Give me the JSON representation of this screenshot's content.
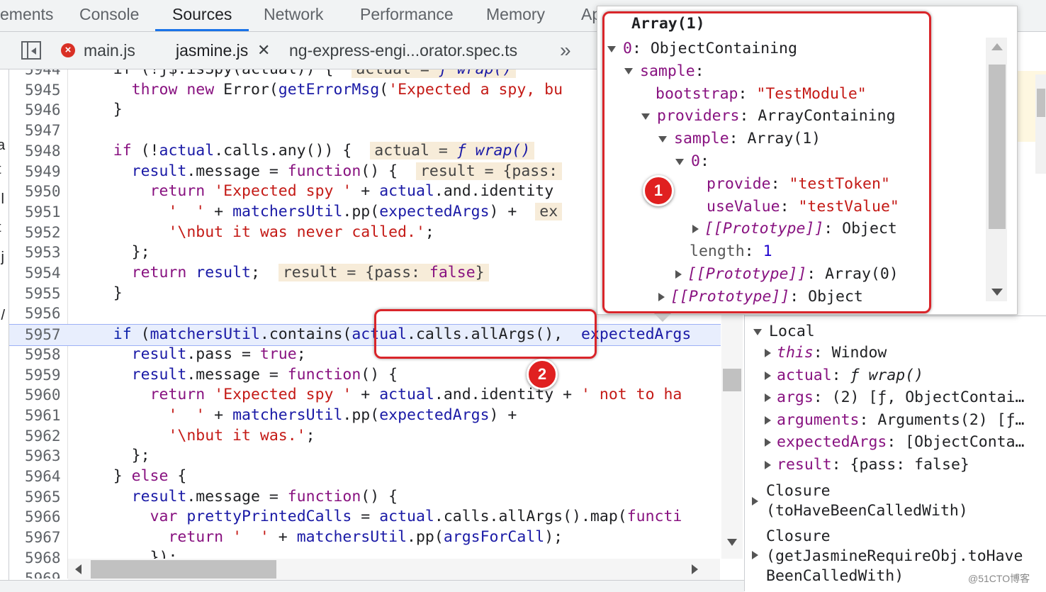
{
  "devtools_tabs": [
    "ements",
    "Console",
    "Sources",
    "Network",
    "Performance",
    "Memory",
    "Ap"
  ],
  "active_tab": "Sources",
  "file_tabs": [
    {
      "label": "main.js",
      "error": true
    },
    {
      "label": "jasmine.js",
      "active": true,
      "close": "✕"
    },
    {
      "label": "ng-express-engi...orator.spec.ts"
    }
  ],
  "more_tabs": "»",
  "nav_fragments": [
    ":",
    "a",
    "t",
    ".l",
    "t",
    ".j",
    ":/"
  ],
  "code_lines": [
    {
      "n": "5944",
      "html": "    if (!j$.isSpy(actual)) {  <span class=\"pill\">actual = <i>ƒ wrap()</i></span>"
    },
    {
      "n": "5945",
      "html": "      <span class=\"kw\">throw new</span> Error(<span class=\"fn\">getErrorMsg</span>(<span class=\"str\">'Expected a spy, bu</span>"
    },
    {
      "n": "5946",
      "html": "    }"
    },
    {
      "n": "5947",
      "html": ""
    },
    {
      "n": "5948",
      "html": "    <span class=\"kw\">if</span> (!<span class=\"var\">actual</span>.calls.any()) {  <span class=\"pill\">actual = <i>ƒ wrap()</i></span>"
    },
    {
      "n": "5949",
      "html": "      <span class=\"var\">result</span>.message = <span class=\"kw\">function</span>() {  <span class=\"pill\">result = {pass:</span>"
    },
    {
      "n": "5950",
      "html": "        <span class=\"kw\">return</span> <span class=\"str\">'Expected spy '</span> + <span class=\"var\">actual</span>.and.identity"
    },
    {
      "n": "5951",
      "html": "          <span class=\"str\">'  '</span> + <span class=\"var\">matchersUtil</span>.pp(<span class=\"var\">expectedArgs</span>) +  <span class=\"pill\">ex</span>"
    },
    {
      "n": "5952",
      "html": "          <span class=\"str\">'\\nbut it was never called.'</span>;"
    },
    {
      "n": "5953",
      "html": "      };"
    },
    {
      "n": "5954",
      "html": "      <span class=\"kw\">return</span> <span class=\"var\">result</span>;  <span class=\"pill\">result = {pass: <span class=\"kw\">false</span>}</span>"
    },
    {
      "n": "5955",
      "html": "    }"
    },
    {
      "n": "5956",
      "html": ""
    },
    {
      "n": "5957",
      "html": "    <span class=\"kwb\">if</span> (<span class=\"var\">matchersUtil</span>.contains(<span class=\"var\">actual</span>.calls.allArgs(),  <span class=\"var\">expectedArgs</span>",
      "exec": true
    },
    {
      "n": "5958",
      "html": "      <span class=\"var\">result</span>.pass = <span class=\"kw\">true</span>;"
    },
    {
      "n": "5959",
      "html": "      <span class=\"var\">result</span>.message = <span class=\"kw\">function</span>() {"
    },
    {
      "n": "5960",
      "html": "        <span class=\"kw\">return</span> <span class=\"str\">'Expected spy '</span> + <span class=\"var\">actual</span>.and.identity + <span class=\"str\">' not to ha</span>"
    },
    {
      "n": "5961",
      "html": "          <span class=\"str\">'  '</span> + <span class=\"var\">matchersUtil</span>.pp(<span class=\"var\">expectedArgs</span>) +"
    },
    {
      "n": "5962",
      "html": "          <span class=\"str\">'\\nbut it was.'</span>;"
    },
    {
      "n": "5963",
      "html": "      };"
    },
    {
      "n": "5964",
      "html": "    } <span class=\"kw\">else</span> {"
    },
    {
      "n": "5965",
      "html": "      <span class=\"var\">result</span>.message = <span class=\"kw\">function</span>() {"
    },
    {
      "n": "5966",
      "html": "        <span class=\"kw\">var</span> <span class=\"var\">prettyPrintedCalls</span> = <span class=\"var\">actual</span>.calls.allArgs().map(<span class=\"kw\">functi</span>"
    },
    {
      "n": "5967",
      "html": "          <span class=\"kw\">return</span> <span class=\"str\">'  '</span> + <span class=\"var\">matchersUtil</span>.pp(<span class=\"var\">argsForCall</span>);"
    },
    {
      "n": "5968",
      "html": "        });"
    },
    {
      "n": "5969",
      "html": ""
    }
  ],
  "popover": {
    "title": "Array(1)",
    "rows": [
      {
        "indent": 0,
        "tri": "d",
        "html": "<span class=\"ppurp\">0</span>: ObjectContaining"
      },
      {
        "indent": 1,
        "tri": "d",
        "html": "<span class=\"ppurp\">sample</span>:"
      },
      {
        "indent": 2,
        "tri": "",
        "html": "<span class=\"ppurp\">bootstrap</span>: <span class=\"pstr\">\"TestModule\"</span>"
      },
      {
        "indent": 2,
        "tri": "d",
        "html": "<span class=\"ppurp\">providers</span>: ArrayContaining"
      },
      {
        "indent": 3,
        "tri": "d",
        "html": "<span class=\"ppurp\">sample</span>: Array(1)"
      },
      {
        "indent": 4,
        "tri": "d",
        "html": "<span class=\"ppurp\">0</span>:"
      },
      {
        "indent": 5,
        "tri": "",
        "html": "<span class=\"ppurp\">provide</span>: <span class=\"pstr\">\"testToken\"</span>"
      },
      {
        "indent": 5,
        "tri": "",
        "html": "<span class=\"ppurp\">useValue</span>: <span class=\"pstr\">\"testValue\"</span>"
      },
      {
        "indent": 5,
        "tri": "r",
        "html": "<i class=\"ppurp\">[[Prototype]]</i>: Object"
      },
      {
        "indent": 4,
        "tri": "",
        "html": "<span class=\"pgray\">length</span>: <span class=\"pnum\">1</span>"
      },
      {
        "indent": 4,
        "tri": "r",
        "html": "<i class=\"ppurp\">[[Prototype]]</i>: Array(0)"
      },
      {
        "indent": 3,
        "tri": "r",
        "html": "<i class=\"ppurp\">[[Prototype]]</i>: Object"
      }
    ]
  },
  "scope": {
    "header": "Local",
    "items": [
      {
        "name": "this",
        "italic": true,
        "value": "Window"
      },
      {
        "name": "actual",
        "value": "ƒ wrap()",
        "value_italic": true
      },
      {
        "name": "args",
        "value": "(2) [ƒ, ObjectContai…"
      },
      {
        "name": "arguments",
        "value": "Arguments(2) [ƒ…"
      },
      {
        "name": "expectedArgs",
        "value": "[ObjectConta…"
      },
      {
        "name": "result",
        "value": "{pass: false}"
      }
    ],
    "closure1": [
      "Closure",
      "(toHaveBeenCalledWith)"
    ],
    "closure2": [
      "Closure",
      "(getJasmineRequireObj.toHave",
      "BeenCalledWith)"
    ]
  },
  "annotations": {
    "badge1": "1",
    "badge2": "2"
  },
  "watermark": "@51CTO博客"
}
